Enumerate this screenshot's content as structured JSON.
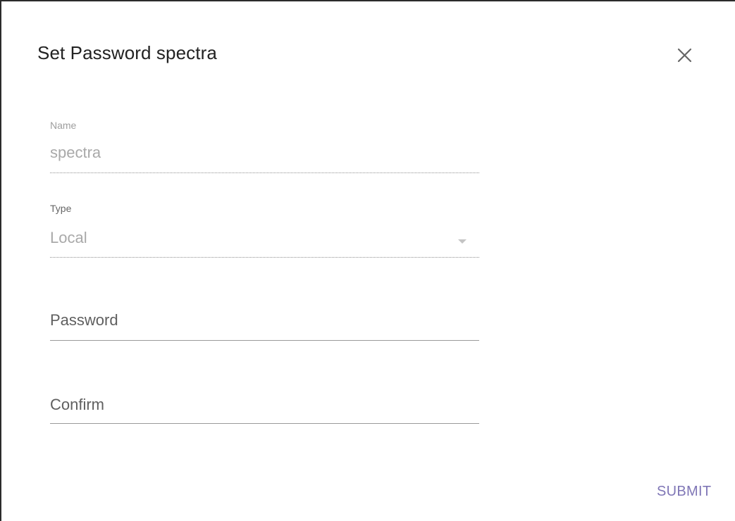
{
  "dialog": {
    "title": "Set Password spectra",
    "close_icon": "close-icon"
  },
  "fields": {
    "name": {
      "label": "Name",
      "value": "spectra"
    },
    "type": {
      "label": "Type",
      "value": "Local",
      "arrow_icon": "chevron-down-icon"
    },
    "password": {
      "placeholder": "Password"
    },
    "confirm": {
      "placeholder": "Confirm"
    }
  },
  "actions": {
    "submit_label": "SUBMIT"
  },
  "colors": {
    "accent": "#7f76b6",
    "text_primary": "#222222",
    "text_disabled": "#a9a9a9"
  }
}
